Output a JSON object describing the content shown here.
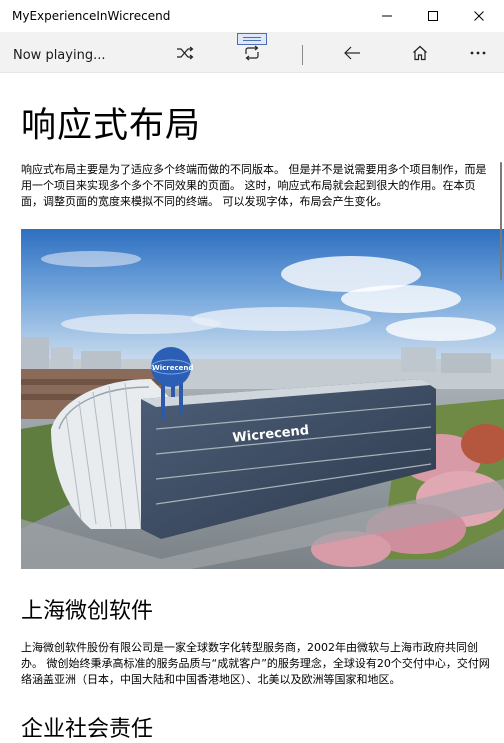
{
  "window": {
    "title": "MyExperienceInWicrecend"
  },
  "command_bar": {
    "now_playing": "Now playing...",
    "icons": [
      "shuffle-icon",
      "repeat-icon",
      "back-arrow-icon",
      "home-icon",
      "more-icon"
    ]
  },
  "page": {
    "title": "响应式布局",
    "intro": "响应式布局主要是为了适应多个终端而做的不同版本。 但是并不是说需要用多个项目制作，而是用一个项目来实现多个多个不同效果的页面。 这时，响应式布局就会起到很大的作用。在本页面，调整页面的宽度来模拟不同的终端。 可以发现字体，布局会产生变化。",
    "hero_image": {
      "building_sign": "Wicrecend",
      "globe_sign": "Wicrecend"
    },
    "company_heading": "上海微创软件",
    "company_text": "上海微创软件股份有限公司是一家全球数字化转型服务商，2002年由微软与上海市政府共同创办。 微创始终秉承高标准的服务品质与“成就客户”的服务理念，全球设有20个交付中心，交付网络涵盖亚洲（日本，中国大陆和中国香港地区）、北美以及欧洲等国家和地区。",
    "csr_heading": "企业社会责任"
  },
  "colors": {
    "titlebar": "#ffffff",
    "command_bar": "#f2f2f2",
    "accent": "#4a6fb5"
  }
}
